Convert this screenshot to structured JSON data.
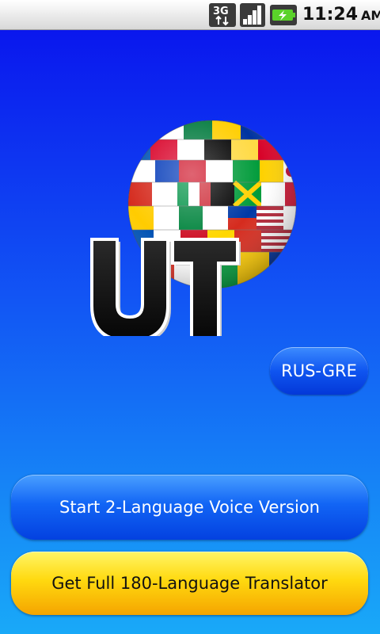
{
  "status_bar": {
    "network_label": "3G",
    "network_icon": "3g-data-icon",
    "signal_icon": "signal-strength-icon",
    "battery_icon": "battery-charging-icon",
    "time": "11:24",
    "ampm": "AM"
  },
  "logo": {
    "letters": "UT",
    "icon": "flag-globe-logo"
  },
  "language_pair_button": {
    "label": "RUS-GRE"
  },
  "voice_button": {
    "label": "Start 2-Language Voice Version"
  },
  "full_button": {
    "label": "Get Full 180-Language Translator"
  },
  "colors": {
    "background_top": "#0a17ee",
    "background_bottom": "#19a9f8",
    "blue_button": "#1265f5",
    "yellow_button": "#ffd90f"
  }
}
